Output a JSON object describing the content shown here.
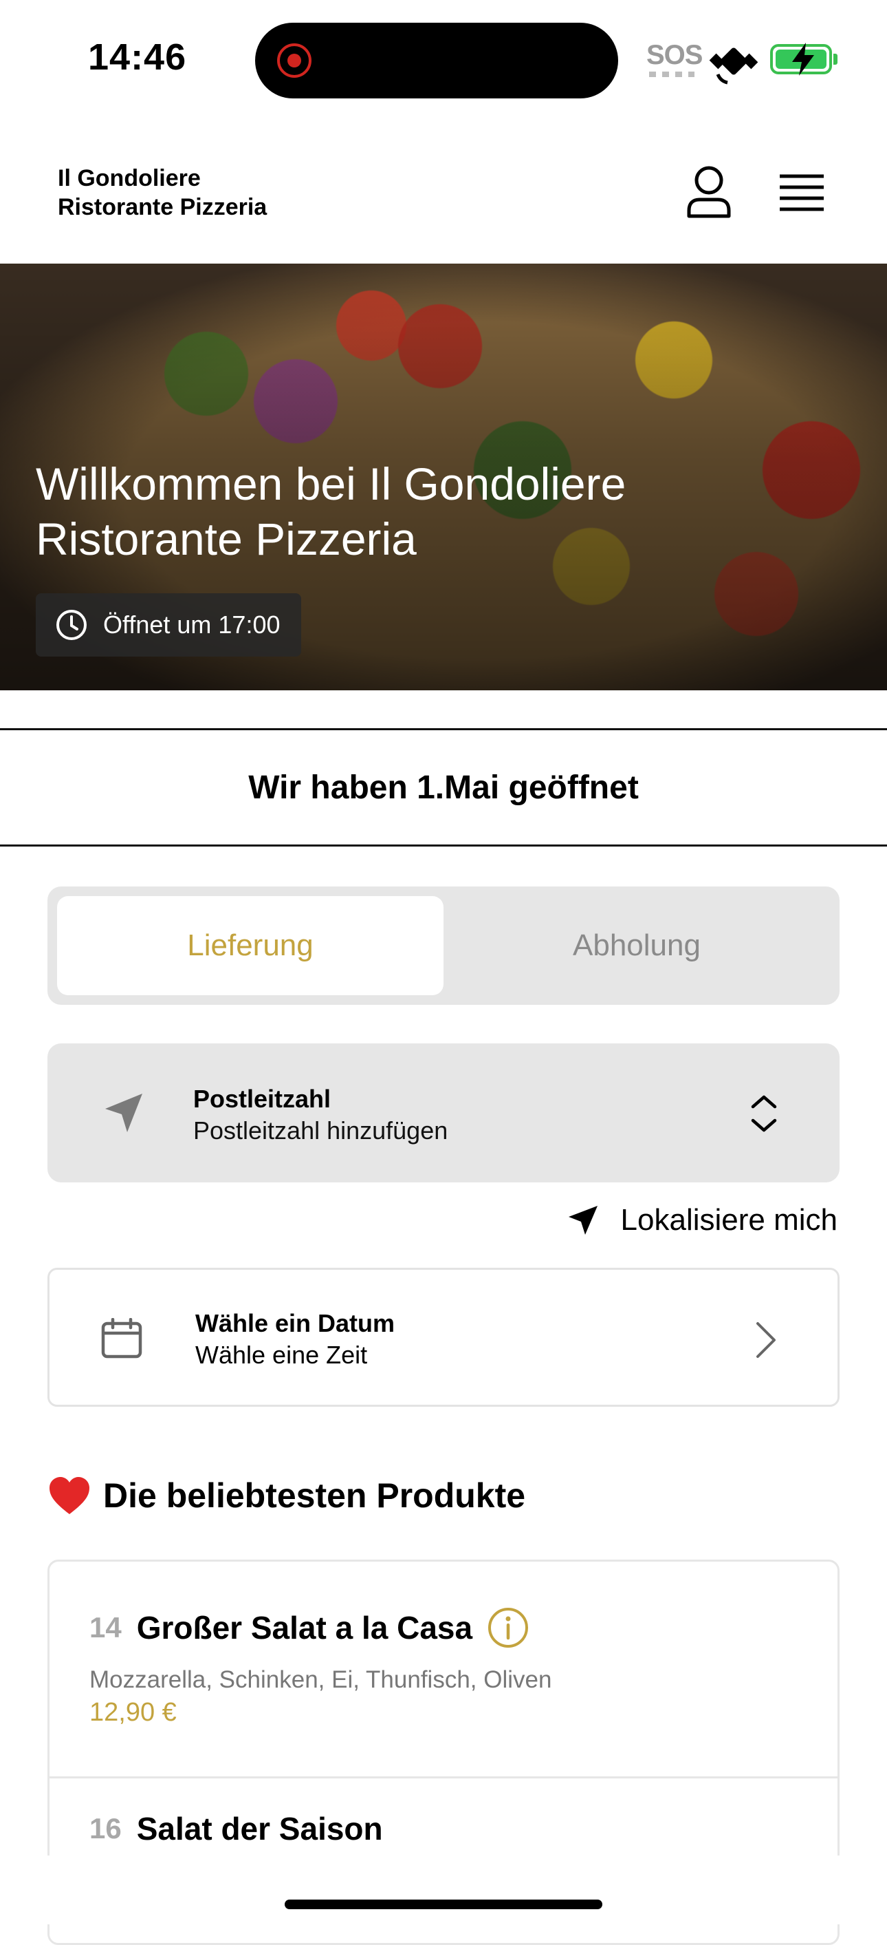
{
  "status_bar": {
    "time": "14:46",
    "sos": "SOS"
  },
  "header": {
    "brand_line1": "Il Gondoliere",
    "brand_line2": "Ristorante Pizzeria"
  },
  "hero": {
    "title_line1": "Willkommen bei Il Gondoliere",
    "title_line2": "Ristorante Pizzeria",
    "opening_label": "Öffnet um 17:00"
  },
  "announcement": "Wir haben 1.Mai geöffnet",
  "order_mode": {
    "tabs": [
      "Lieferung",
      "Abholung"
    ],
    "selected": "Lieferung"
  },
  "postcode": {
    "title": "Postleitzahl",
    "placeholder": "Postleitzahl hinzufügen"
  },
  "locate_label": "Lokalisiere mich",
  "date_picker": {
    "title": "Wähle ein Datum",
    "subtitle": "Wähle eine Zeit"
  },
  "popular": {
    "title": "Die beliebtesten Produkte",
    "items": [
      {
        "number": "14",
        "name": "Großer Salat a la Casa",
        "description": "Mozzarella, Schinken, Ei, Thunfisch, Oliven",
        "price": "12,90 €"
      },
      {
        "number": "16",
        "name": "Salat der Saison"
      }
    ]
  },
  "colors": {
    "accent": "#c3a33e",
    "segment_bg": "#e6e6e6",
    "recording": "#d1251f",
    "battery": "#34c759"
  },
  "icons": [
    "record-icon",
    "satellite-icon",
    "battery-icon",
    "user-icon",
    "menu-icon",
    "clock-icon",
    "location-arrow-icon",
    "chevron-updown-icon",
    "calendar-icon",
    "chevron-right-icon",
    "heart-icon",
    "info-icon"
  ]
}
